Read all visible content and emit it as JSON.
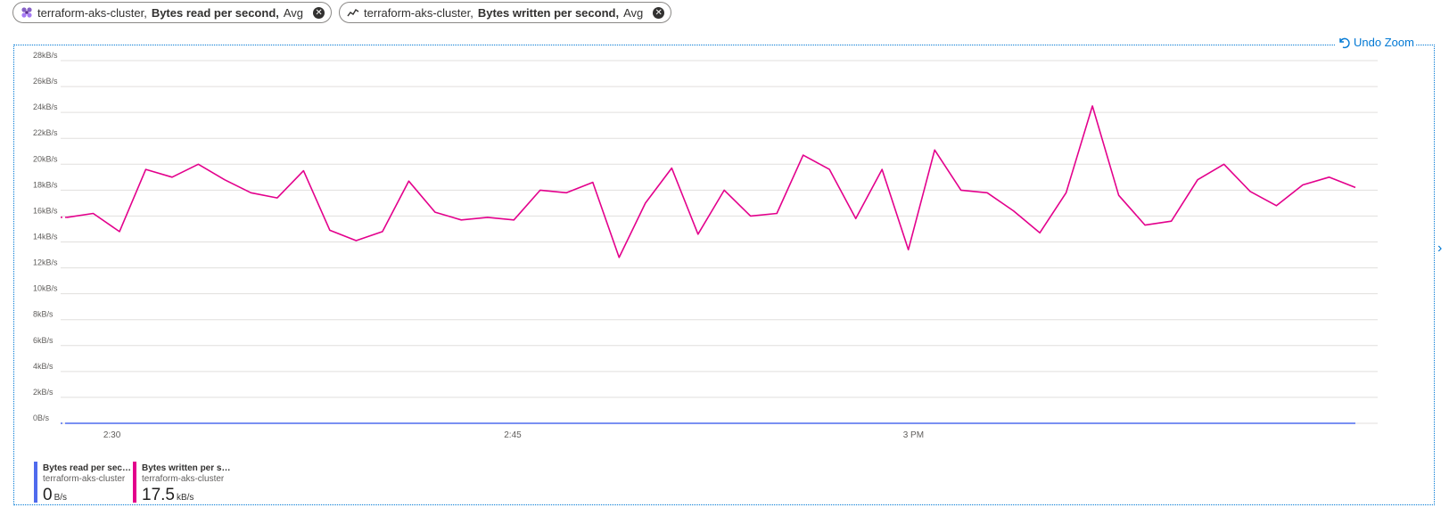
{
  "pills": [
    {
      "resource": "terraform-aks-cluster,",
      "metric": "Bytes read per second,",
      "agg": "Avg",
      "icon": "cluster-icon"
    },
    {
      "resource": "terraform-aks-cluster,",
      "metric": "Bytes written per second,",
      "agg": "Avg",
      "icon": "line-chart-icon"
    }
  ],
  "toolbar": {
    "undo_zoom": "Undo Zoom"
  },
  "legend": [
    {
      "title": "Bytes read per secon...",
      "sub": "terraform-aks-cluster",
      "value": "0",
      "unit": "B/s",
      "color": "#4f6bed"
    },
    {
      "title": "Bytes written per se...",
      "sub": "terraform-aks-cluster",
      "value": "17.5",
      "unit": "kB/s",
      "color": "#e3008c"
    }
  ],
  "chart_data": {
    "type": "line",
    "ylim": [
      0,
      28
    ],
    "yticks": [
      "0B/s",
      "2kB/s",
      "4kB/s",
      "6kB/s",
      "8kB/s",
      "10kB/s",
      "12kB/s",
      "14kB/s",
      "16kB/s",
      "18kB/s",
      "20kB/s",
      "22kB/s",
      "24kB/s",
      "26kB/s",
      "28kB/s"
    ],
    "xticks": [
      {
        "label": "2:30",
        "t": 0.035
      },
      {
        "label": "2:45",
        "t": 0.346
      },
      {
        "label": "3 PM",
        "t": 0.657
      }
    ],
    "series": [
      {
        "name": "Bytes read per second",
        "color": "#4f6bed",
        "values": [
          0,
          0,
          0,
          0,
          0,
          0,
          0,
          0,
          0,
          0,
          0,
          0,
          0,
          0,
          0,
          0,
          0,
          0,
          0,
          0,
          0,
          0,
          0,
          0,
          0,
          0,
          0,
          0,
          0,
          0,
          0,
          0,
          0,
          0,
          0,
          0,
          0,
          0,
          0,
          0,
          0,
          0,
          0,
          0,
          0,
          0,
          0,
          0,
          0,
          0,
          0
        ]
      },
      {
        "name": "Bytes written per second",
        "color": "#e3008c",
        "values": [
          15.9,
          16.2,
          14.8,
          19.6,
          19.0,
          20.0,
          18.8,
          17.8,
          17.4,
          19.5,
          14.9,
          14.1,
          14.8,
          18.7,
          16.3,
          15.7,
          15.9,
          15.7,
          18.0,
          17.8,
          18.6,
          12.8,
          17.0,
          19.7,
          14.6,
          18.0,
          16.0,
          16.2,
          20.7,
          19.6,
          15.8,
          19.6,
          13.4,
          21.1,
          18.0,
          17.8,
          16.4,
          14.7,
          17.8,
          24.5,
          17.6,
          15.3,
          15.6,
          18.8,
          20.0,
          17.9,
          16.8,
          18.4,
          19.0,
          18.2
        ]
      }
    ]
  }
}
